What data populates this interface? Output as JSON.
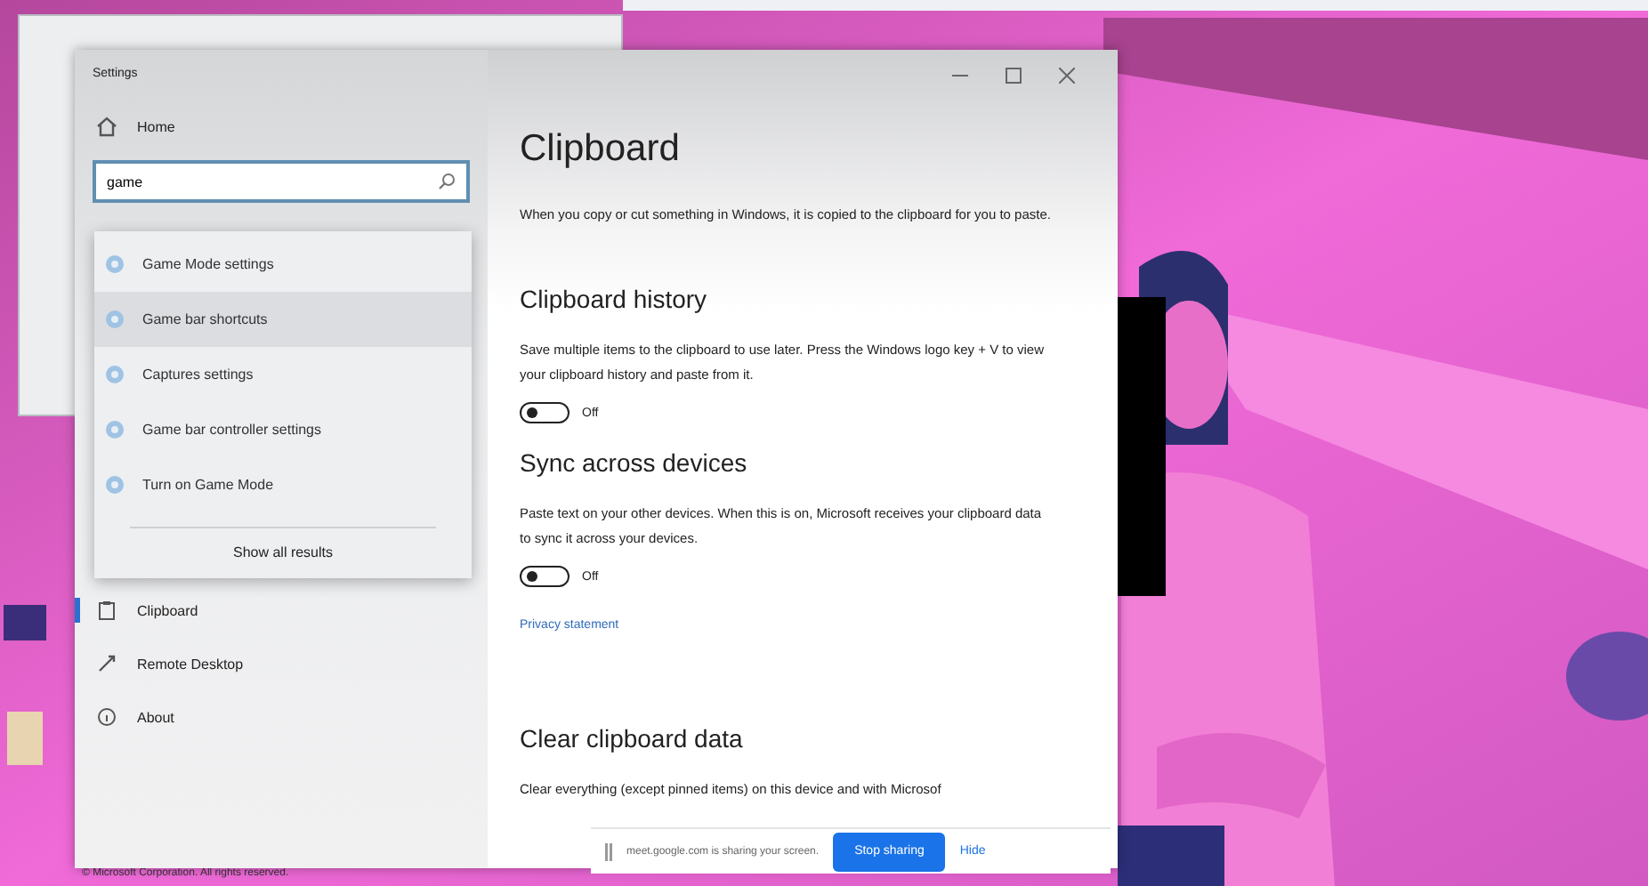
{
  "window": {
    "title": "Settings"
  },
  "sidebar": {
    "home": "Home",
    "search": {
      "value": "game"
    },
    "suggestions": [
      {
        "label": "Game Mode settings",
        "selected": false
      },
      {
        "label": "Game bar shortcuts",
        "selected": true
      },
      {
        "label": "Captures settings",
        "selected": false
      },
      {
        "label": "Game bar controller settings",
        "selected": false
      },
      {
        "label": "Turn on Game Mode",
        "selected": false
      }
    ],
    "show_all": "Show all results",
    "items": [
      {
        "label": "Clipboard",
        "kind": "clipboard",
        "selected": true
      },
      {
        "label": "Remote Desktop",
        "kind": "remote",
        "selected": false
      },
      {
        "label": "About",
        "kind": "about",
        "selected": false
      }
    ]
  },
  "content": {
    "title": "Clipboard",
    "intro": "When you copy or cut something in Windows, it is copied to the clipboard for you to paste.",
    "sections": [
      {
        "heading": "Clipboard history",
        "text": "Save multiple items to the clipboard to use later. Press the Windows logo key + V to view your clipboard history and paste from it.",
        "toggle": {
          "on": false,
          "label": "Off"
        }
      },
      {
        "heading": "Sync across devices",
        "text": "Paste text on your other devices. When this is on, Microsoft receives your clipboard data to sync it across your devices.",
        "toggle": {
          "on": false,
          "label": "Off"
        },
        "link": "Privacy statement"
      },
      {
        "heading": "Clear clipboard data",
        "text": "Clear everything (except pinned items) on this device and with Microsof"
      }
    ]
  },
  "sharing_bar": {
    "message": "meet.google.com is sharing your screen.",
    "stop": "Stop sharing",
    "hide": "Hide"
  },
  "footer": "© Microsoft Corporation. All rights reserved."
}
